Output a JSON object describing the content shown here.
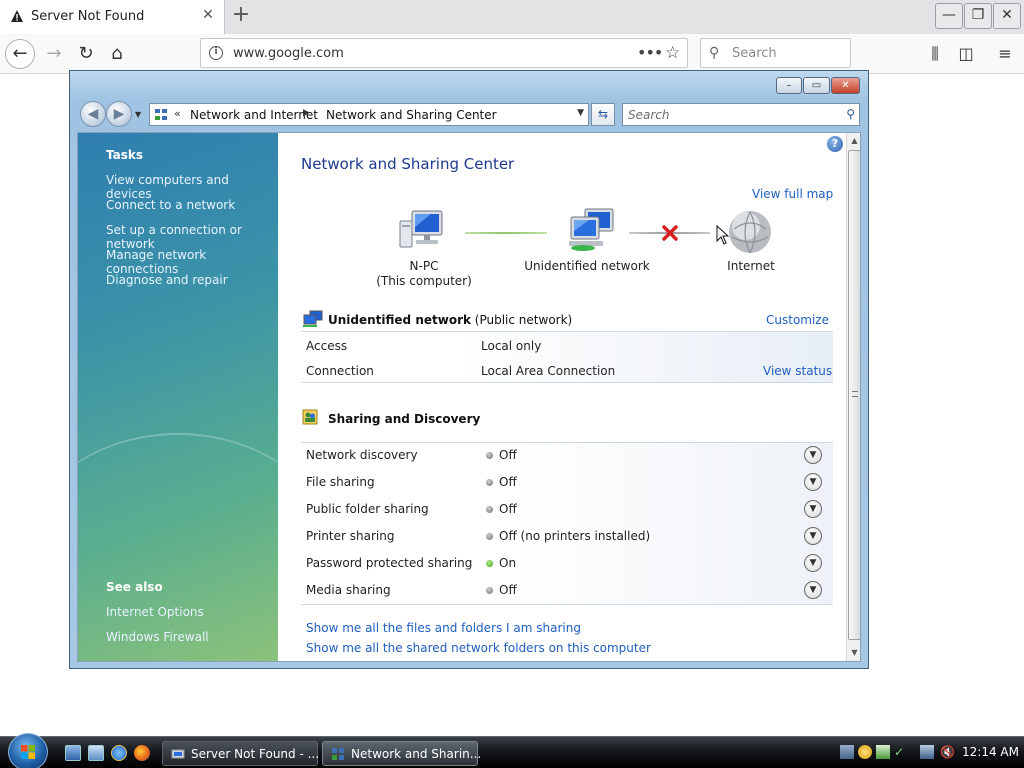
{
  "browser": {
    "tab_title": "Server Not Found",
    "new_tab_symbol": "+",
    "url": "www.google.com",
    "search_placeholder": "Search",
    "icons": [
      "warning-icon",
      "back-icon",
      "forward-icon",
      "reload-icon",
      "home-icon",
      "info-icon",
      "page-actions-icon",
      "bookmark-star-icon",
      "search-icon",
      "library-icon",
      "sidebar-icon",
      "menu-icon"
    ]
  },
  "explorer": {
    "breadcrumb": [
      "Network and Internet",
      "Network and Sharing Center"
    ],
    "search_placeholder": "Search",
    "sidebar": {
      "tasks_heading": "Tasks",
      "tasks": [
        "View computers and devices",
        "Connect to a network",
        "Set up a connection or network",
        "Manage network connections",
        "Diagnose and repair"
      ],
      "see_also_heading": "See also",
      "see_also": [
        "Internet Options",
        "Windows Firewall"
      ]
    },
    "main": {
      "title": "Network and Sharing Center",
      "view_full_map": "View full map",
      "map": {
        "computer_name": "N-PC",
        "computer_sub": "(This computer)",
        "network": "Unidentified network",
        "internet": "Internet"
      },
      "network_section": {
        "name": "Unidentified network",
        "type": "(Public network)",
        "customize": "Customize",
        "rows": [
          {
            "label": "Access",
            "value": "Local only",
            "action": ""
          },
          {
            "label": "Connection",
            "value": "Local Area Connection",
            "action": "View status"
          }
        ]
      },
      "sharing_section": {
        "title": "Sharing and Discovery",
        "rows": [
          {
            "label": "Network discovery",
            "value": "Off",
            "on": false
          },
          {
            "label": "File sharing",
            "value": "Off",
            "on": false
          },
          {
            "label": "Public folder sharing",
            "value": "Off",
            "on": false
          },
          {
            "label": "Printer sharing",
            "value": "Off (no printers installed)",
            "on": false
          },
          {
            "label": "Password protected sharing",
            "value": "On",
            "on": true
          },
          {
            "label": "Media sharing",
            "value": "Off",
            "on": false
          }
        ]
      },
      "bottom_links": [
        "Show me all the files and folders I am sharing",
        "Show me all the shared network folders on this computer"
      ]
    }
  },
  "taskbar": {
    "tasks": [
      "Server Not Found - ...",
      "Network and Sharin..."
    ],
    "clock": "12:14 AM"
  },
  "colors": {
    "link": "#1e5fbf",
    "title_blue": "#1e3a8f",
    "status_on": "#2a9a1a",
    "status_off": "#6e6e6e",
    "error_x": "#d62020"
  }
}
